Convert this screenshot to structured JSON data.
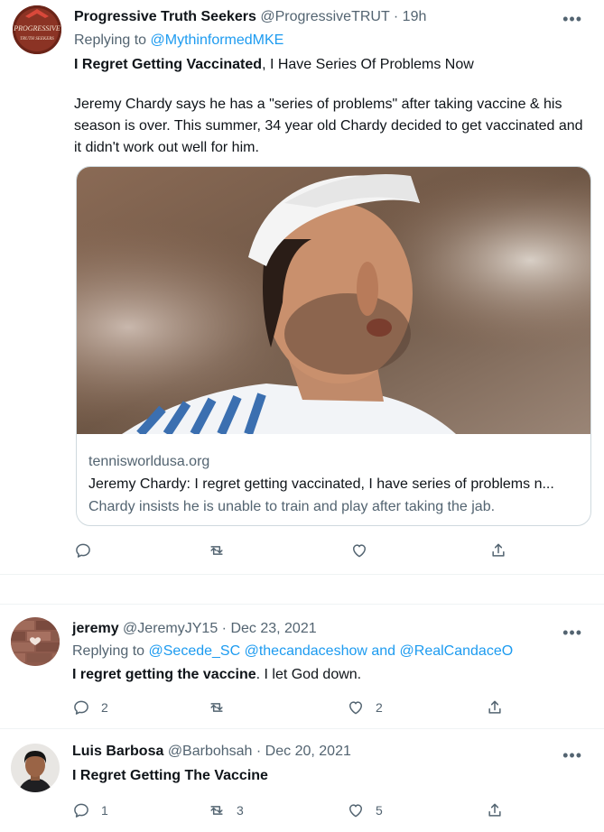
{
  "tweets": [
    {
      "author_name": "Progressive Truth Seekers",
      "handle": "@ProgressiveTRUT",
      "time": "· 19h",
      "replying_label": "Replying to",
      "replying_to": "@MythinformedMKE",
      "body_bold": "I Regret Getting Vaccinated",
      "body_rest": ", I Have Series Of Problems Now",
      "body_paragraph": "Jeremy Chardy says he has a \"series of problems\" after taking vaccine & his season is over. This summer, 34 year old Chardy decided to get vaccinated and it didn't work out well for him.",
      "avatar_text_1": "PROGRESSIVE",
      "avatar_text_2": "TRUTH SEEKERS",
      "card": {
        "domain": "tennisworldusa.org",
        "title": "Jeremy Chardy: I regret getting vaccinated, I have series of problems n...",
        "description": "Chardy insists he is unable to train and play after taking the jab."
      },
      "more_icon": "more-icon"
    },
    {
      "author_name": "jeremy",
      "handle": "@JeremyJY15",
      "time": "· Dec 23, 2021",
      "replying_label": "Replying to",
      "replying_to_1": "@Secede_SC",
      "replying_to_2": "@thecandaceshow",
      "replying_and": "and",
      "replying_to_3": "@RealCandaceO",
      "body_bold": "I regret getting the vaccine",
      "body_rest": ". I let God down.",
      "reply_count": "2",
      "like_count": "2"
    },
    {
      "author_name": "Luis Barbosa",
      "handle": "@Barbohsah",
      "time": "· Dec 20, 2021",
      "body_bold": "I Regret Getting The Vaccine",
      "reply_count": "1",
      "retweet_count": "3",
      "like_count": "5"
    }
  ],
  "icons": {
    "reply": "reply-icon",
    "retweet": "retweet-icon",
    "like": "heart-icon",
    "share": "share-icon",
    "more": "more-icon"
  },
  "colors": {
    "link": "#1d9bf0",
    "secondary_text": "#536471",
    "primary_text": "#0f1419",
    "border": "#cfd9de"
  }
}
